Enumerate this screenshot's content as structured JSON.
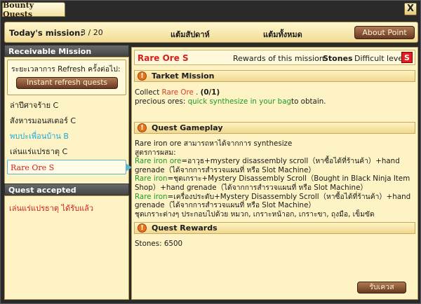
{
  "window": {
    "title": "Bounty Quests",
    "close_label": "X"
  },
  "mission_bar": {
    "label": "Today's mission:",
    "count": "3 / 20",
    "score1": "แต้มสัปดาห์",
    "score2": "แต้มทั้งหมด",
    "about_label": "About Point"
  },
  "receivable": {
    "header": "Receivable Mission",
    "refresh_text": "ระยะเวลาการ Refresh ครั้งต่อไป:",
    "refresh_button": "Instant refresh quests",
    "items": [
      {
        "label": "ล่าปีศาจร้าย C",
        "color": "#1a1a1a"
      },
      {
        "label": "สังหารมอนสเตอร์ C",
        "color": "#1a1a1a"
      },
      {
        "label": "พบปะเพื่อนบ้าน B",
        "color": "#1aa8d8"
      },
      {
        "label": "เล่นแร่แปรธาตุ C",
        "color": "#1a1a1a"
      },
      {
        "label": "Rare Ore S",
        "color": "#d42020"
      }
    ]
  },
  "accepted": {
    "header": "Quest accepted",
    "items": [
      "เล่นแร่แปรธาตุ ได้รับแล้ว"
    ]
  },
  "detail": {
    "name": "Rare Ore S",
    "rewards_label": "Rewards of this mission:",
    "rewards_value": "Stones",
    "difficulty_label": "Difficult level:",
    "difficulty": "S",
    "target": {
      "title": "Tarket Mission",
      "collect_prefix": "Collect ",
      "collect_item": "Rare Ore",
      "collect_suffix": " .   ",
      "progress": "(0/1)",
      "line2_prefix": "precious ores: ",
      "line2_link": "quick synthesize in your bag",
      "line2_suffix": "to obtain."
    },
    "gameplay": {
      "title": "Quest Gameplay",
      "line1": "Rare iron ore สามารถหาได้จากการ synthesize",
      "line2": "สูตรการผสม:",
      "r1_item": "Rare iron ore",
      "r1_text": "=อาวุธ+mystery disassembly scroll（หาซื้อได้ที่ร้านค้า）+hand grenade（ได้จากการสำรวจแผนที่ หรือ Slot Machine）",
      "r2_item": "Rare iron",
      "r2_text": "=ชุดเกราะ+Mystery Disassembly Scroll（Bought in Black Ninja Item Shop）+hand grenade（ได้จากการสำรวจแผนที่ หรือ Slot Machine）",
      "r3_item": "Rare iron",
      "r3_text": "=เครื่องประดับ+Mystery Disassembly Scroll（หาซื้อได้ที่ร้านค้า）+hand grenade（ได้จากการสำรวจแผนที่ หรือ Slot Machine）",
      "line_last": "ชุดเกราะต่างๆ ประกอบไปด้วย หมวก, เกราะหน้าอก, เกราะขา, ถุงมือ, เข็มขัด"
    },
    "rewards": {
      "title": "Quest Rewards",
      "text": "Stones: 6500"
    },
    "claim_button": "รับเควส"
  }
}
